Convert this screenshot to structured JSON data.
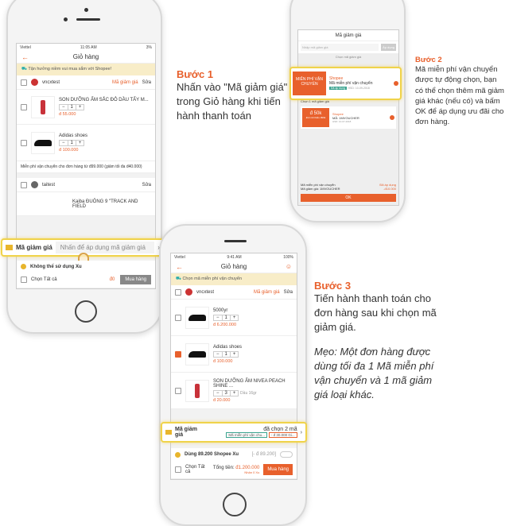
{
  "step1": {
    "title": "Bước 1",
    "body": "Nhấn vào \"Mã giảm giá\" trong Giỏ hàng khi tiến hành thanh toán"
  },
  "step2": {
    "title": "Bước 2",
    "body": "Mã miễn phí vận chuyển được tự động chọn, bạn có thể chọn thêm mã giảm giá khác (nếu có) và bấm OK để áp dụng ưu đãi cho đơn hàng."
  },
  "step3": {
    "title": "Bước 3",
    "body": "Tiến hành thanh toán cho đơn hàng sau khi chọn mã giảm giá.",
    "tip": "Mẹo: Một đơn hàng được dùng tối đa 1 Mã miễn phí vận chuyển và 1 mã giảm giá loại khác."
  },
  "phone1": {
    "status": {
      "carrier": "Viettel",
      "time": "11:05 AM",
      "battery": "3%"
    },
    "title": "Giỏ hàng",
    "banner": "Tận hưởng niềm vui mua sắm với Shopee!",
    "shop1": {
      "name": "vncxtest",
      "voucher": "Mã giảm giá",
      "edit": "Sửa"
    },
    "items": [
      {
        "name": "SON DƯỠNG ẨM SẮC ĐỎ DẦU TẨY M...",
        "qty": "1",
        "price": "đ 55.000"
      },
      {
        "name": "Adidas shoes",
        "qty": "1",
        "price": "đ 100.000"
      }
    ],
    "shipping_note": "Miễn phí vận chuyển cho đơn hàng từ đ99.000 (giảm tối đa đ40.000)",
    "shop2": {
      "name": "taitest",
      "edit": "Sửa"
    },
    "item3": "Kaiba ĐUÔNG 9 \"TRACK AND FIELD",
    "voucher_bar": {
      "label": "Mã giảm giá",
      "placeholder": "Nhấn để áp dụng mã giảm giá"
    },
    "coins": "Không thể sử dụng Xu",
    "select_all": "Chọn Tất cả",
    "total": "đ0",
    "buy": "Mua hàng"
  },
  "phone2": {
    "title": "Mã giảm giá",
    "input_placeholder": "Nhập mã giảm giá",
    "apply": "Áp dụng",
    "choose": "Chọn mã giảm giá",
    "voucher1": {
      "tag": "MIỄN PHÍ VẬN CHUYỂN",
      "shop": "Shopee",
      "name": "Mã miễn phí vận chuyển",
      "badge": "Đã áp dụng",
      "expiry": "HSD: 10-09-2018"
    },
    "more": "Xem tất cả",
    "choose_one": "Chọn 1 mã giảm giá",
    "voucher2": {
      "tag": "đ 50k",
      "sub": "Đơn tối thiểu đ99k",
      "shop": "Shopee",
      "name": "MÃ: 1MVOUCHER",
      "expiry": "HSD: 10-07-2018"
    },
    "summary": [
      {
        "label": "Mã miễn phí vận chuyển",
        "value": "Đã áp dụng"
      },
      {
        "label": "Mã giảm giá: 1MVOUCHER",
        "value": "-đ10.000"
      }
    ],
    "ok": "OK"
  },
  "phone3": {
    "status": {
      "carrier": "Viettel",
      "time": "9:41 AM",
      "battery": "100%"
    },
    "title": "Giỏ hàng",
    "banner": "Chọn mã miễn phí vận chuyển",
    "shop": {
      "name": "vncxtest",
      "voucher": "Mã giảm giá",
      "edit": "Sửa"
    },
    "items": [
      {
        "name": "5000yr",
        "qty": "1",
        "price": "đ 6.200.000",
        "checked": false
      },
      {
        "name": "Adidas shoes",
        "qty": "1",
        "price": "đ 100.000",
        "checked": true
      },
      {
        "name": "SON DƯỠNG ẨM NIVEA PEACH SHINE ...",
        "qty": "3",
        "price": "đ 20.000",
        "checked": false,
        "stock": "Dầu 16gr"
      }
    ],
    "voucher_bar": {
      "label": "Mã giảm giá",
      "selected": "đã chọn 2 mã",
      "chip1": "Mã miễn phí vận chu...",
      "chip2": "- đ 30.000 Gi..."
    },
    "coins": {
      "label": "Dùng 89.200 Shopee Xu",
      "value": "[- đ 89.200]"
    },
    "select_all": "Chọn Tất cả",
    "total_label": "Tổng tiền:",
    "total": "đ1.200.000",
    "coins_earned": "Nhận 0 Xu",
    "buy": "Mua hàng"
  },
  "colors": {
    "accent": "#e8602c",
    "highlight": "#f0d34a",
    "banner": "#f8edc8"
  }
}
